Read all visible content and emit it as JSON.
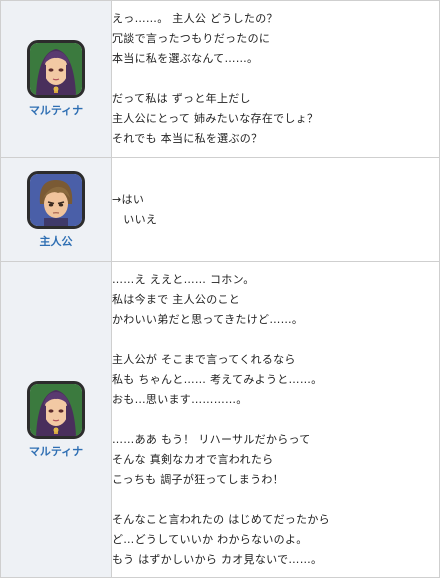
{
  "rows": [
    {
      "speaker": "マルティナ",
      "avatar": "martina-portrait",
      "lines": [
        "えっ……。 主人公 どうしたの？",
        "冗談で言ったつもりだったのに",
        "本当に私を選ぶなんて……。",
        "",
        "だって私は ずっと年上だし",
        "主人公にとって 姉みたいな存在でしょ？",
        "それでも 本当に私を選ぶの？"
      ]
    },
    {
      "speaker": "主人公",
      "avatar": "hero-portrait",
      "choices": [
        "→はい",
        "　いいえ"
      ]
    },
    {
      "speaker": "マルティナ",
      "avatar": "martina-portrait",
      "lines": [
        "……え ええと…… コホン。",
        "私は今まで 主人公のこと",
        "かわいい弟だと思ってきたけど……。",
        "",
        "主人公が そこまで言ってくれるなら",
        "私も ちゃんと…… 考えてみようと……。",
        "おも…思います…………。",
        "",
        "……ああ もう！ リハーサルだからって",
        "そんな 真剣なカオで言われたら",
        "こっちも 調子が狂ってしまうわ！",
        "",
        "そんなこと言われたの はじめてだったから",
        "ど…どうしていいか わからないのよ。",
        "もう はずかしいから カオ見ないで……。"
      ]
    }
  ],
  "colors": {
    "name": "#2f6fb3",
    "speaker_bg": "#eef1f5",
    "border": "#cfcfcf"
  }
}
